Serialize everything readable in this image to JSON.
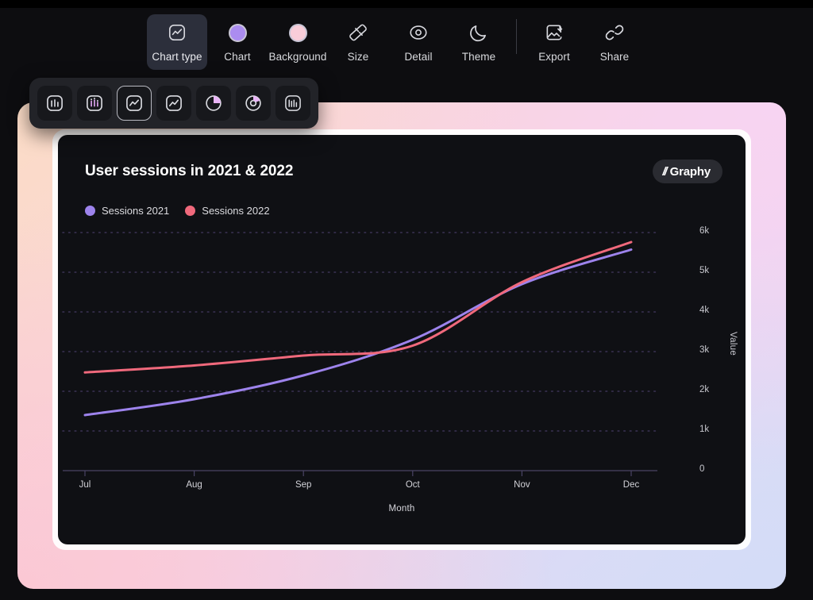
{
  "toolbar": {
    "items": [
      {
        "label": "Chart type",
        "icon": "line-chart-icon",
        "active": true
      },
      {
        "label": "Chart",
        "icon": "purple-circle-swatch-icon",
        "active": false
      },
      {
        "label": "Background",
        "icon": "pink-circle-swatch-icon",
        "active": false
      },
      {
        "label": "Size",
        "icon": "ruler-icon",
        "active": false
      },
      {
        "label": "Detail",
        "icon": "eye-target-icon",
        "active": false
      },
      {
        "label": "Theme",
        "icon": "moon-icon",
        "active": false
      },
      {
        "label": "Export",
        "icon": "image-download-icon",
        "active": false
      },
      {
        "label": "Share",
        "icon": "link-chain-icon",
        "active": false
      }
    ]
  },
  "chart_type_menu": {
    "options": [
      {
        "name": "bar-chart",
        "selected": false
      },
      {
        "name": "column-chart-colored",
        "selected": false
      },
      {
        "name": "line-chart-smooth",
        "selected": true
      },
      {
        "name": "line-chart-sharp",
        "selected": false
      },
      {
        "name": "pie-chart",
        "selected": false
      },
      {
        "name": "donut-chart",
        "selected": false
      },
      {
        "name": "bar-chart-thin",
        "selected": false
      }
    ]
  },
  "card": {
    "title": "User sessions in 2021 & 2022",
    "badge_mark": "//",
    "badge_text": "Graphy"
  },
  "colors": {
    "series_2021": "#9d83ec",
    "series_2022": "#f0697c",
    "card_bg": "#0f1014",
    "page_bg": "#0d0d10",
    "toolbar_active": "#2c2f3b"
  },
  "chart_data": {
    "type": "line",
    "title": "User sessions in 2021 & 2022",
    "xlabel": "Month",
    "ylabel": "Value",
    "categories": [
      "Jul",
      "Aug",
      "Sep",
      "Oct",
      "Nov",
      "Dec"
    ],
    "ylim": [
      0,
      6000
    ],
    "yticks": [
      "0",
      "1k",
      "2k",
      "3k",
      "4k",
      "5k",
      "6k"
    ],
    "ytick_values": [
      0,
      1000,
      2000,
      3000,
      4000,
      5000,
      6000
    ],
    "grid": "horizontal-dotted",
    "legend_position": "top-left",
    "series": [
      {
        "name": "Sessions 2021",
        "color": "#9d83ec",
        "values": [
          1400,
          1800,
          2400,
          3300,
          4700,
          5570
        ]
      },
      {
        "name": "Sessions 2022",
        "color": "#f0697c",
        "values": [
          2475,
          2650,
          2900,
          3150,
          4750,
          5760
        ]
      }
    ]
  }
}
